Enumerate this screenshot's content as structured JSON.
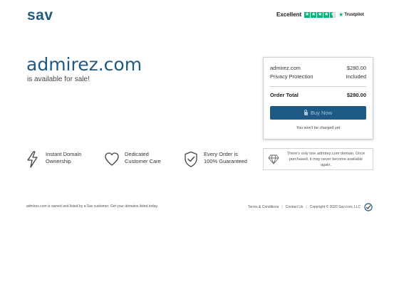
{
  "header": {
    "logo": "sav",
    "trustpilot": {
      "rating_label": "Excellent",
      "brand": "Trustpilot",
      "stars": 4.5
    }
  },
  "hero": {
    "domain": "admirez.com",
    "tagline": "is available for sale!"
  },
  "order": {
    "items": [
      {
        "label": "admirez.com",
        "value": "$280.00"
      },
      {
        "label": "Privacy Protection",
        "value": "Included"
      }
    ],
    "total_label": "Order Total",
    "total_value": "$280.00",
    "buy_label": "Buy Now",
    "note": "You won't be charged yet"
  },
  "features": [
    {
      "icon": "lightning-icon",
      "line1": "Instant Domain",
      "line2": "Ownership"
    },
    {
      "icon": "heart-icon",
      "line1": "Dedicated",
      "line2": "Customer Care"
    },
    {
      "icon": "shield-check-icon",
      "line1": "Every Order is",
      "line2": "100% Guaranteed"
    }
  ],
  "notice": {
    "icon": "diamond-icon",
    "line1": "There's only one admirez.com domain. Once",
    "line2": "purchased, it may never become available again."
  },
  "footer": {
    "left": "admirez.com is owned and listed by a Sav customer. Get your domains listed today.",
    "links": [
      "Terms & Conditions",
      "Contact Us"
    ],
    "copyright": "Copyright © 2020 Sav.com, LLC"
  },
  "colors": {
    "brand": "#1f5a86",
    "trustpilot_green": "#00b67a"
  }
}
